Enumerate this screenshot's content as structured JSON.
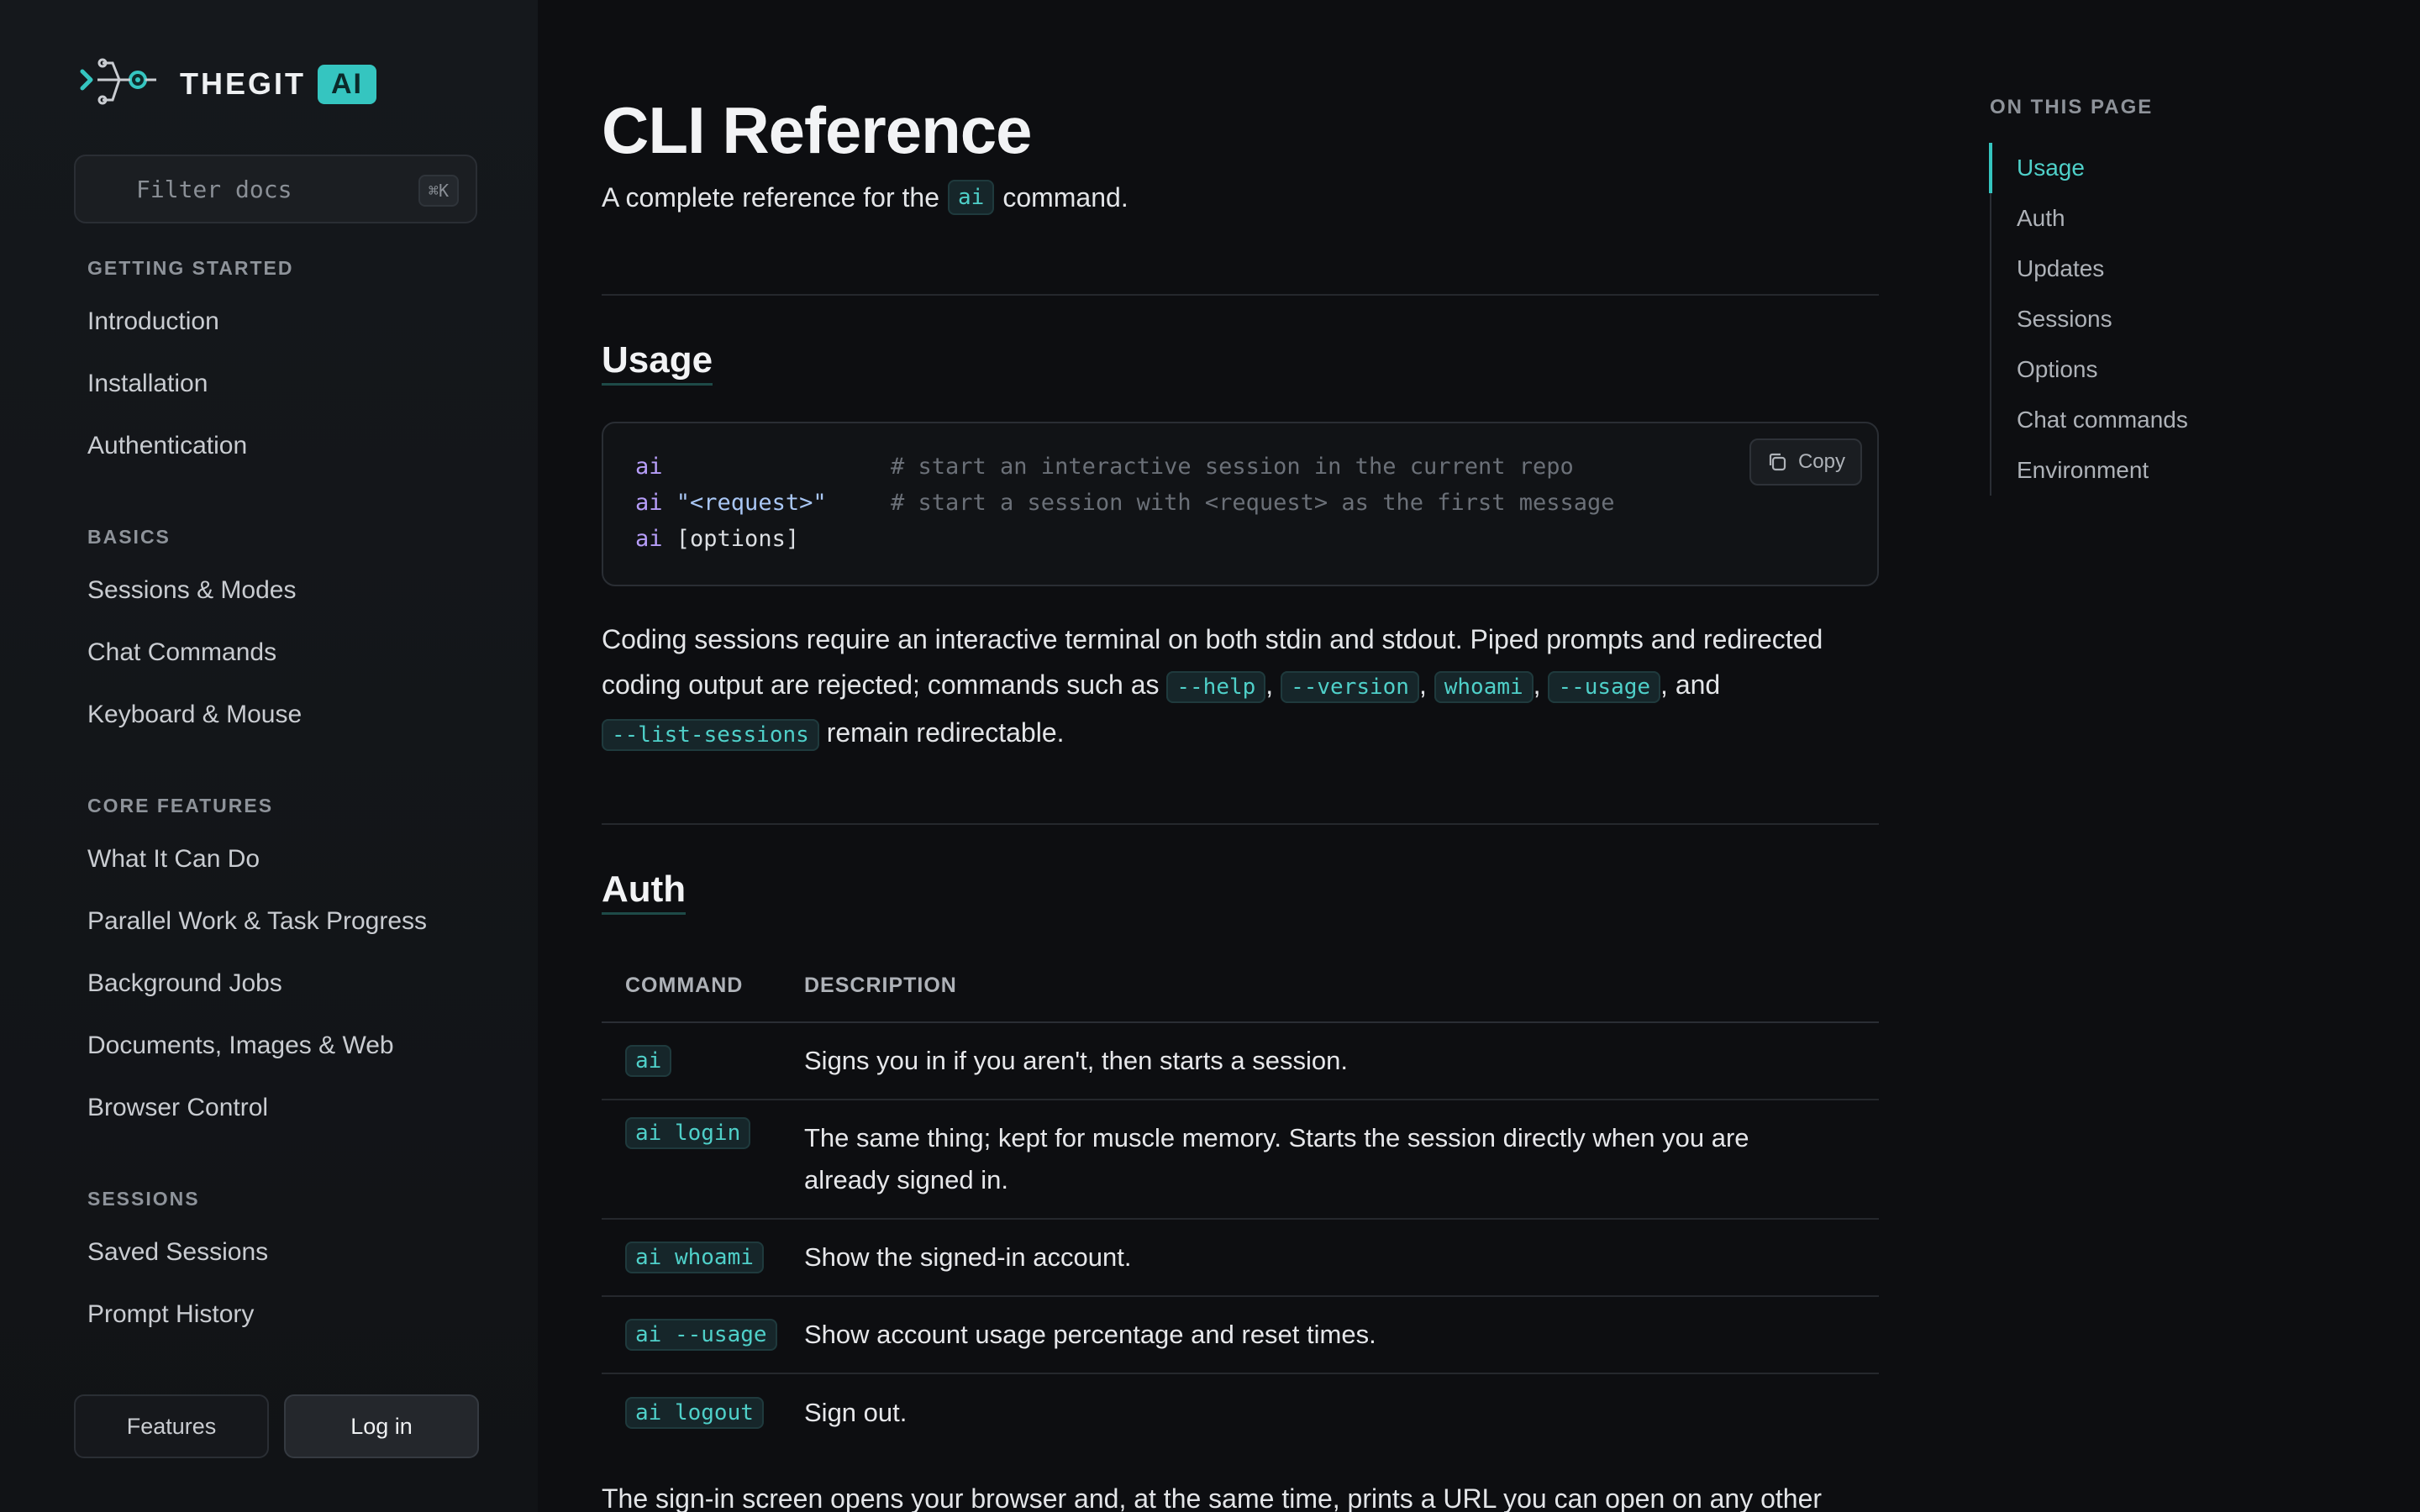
{
  "brand": {
    "name": "THEGIT",
    "badge": "AI"
  },
  "sidebar": {
    "filter_placeholder": "Filter docs",
    "shortcut": "⌘K",
    "sections": [
      {
        "heading": "GETTING STARTED",
        "items": [
          "Introduction",
          "Installation",
          "Authentication"
        ]
      },
      {
        "heading": "BASICS",
        "items": [
          "Sessions & Modes",
          "Chat Commands",
          "Keyboard & Mouse"
        ]
      },
      {
        "heading": "CORE FEATURES",
        "items": [
          "What It Can Do",
          "Parallel Work & Task Progress",
          "Background Jobs",
          "Documents, Images & Web",
          "Browser Control"
        ]
      },
      {
        "heading": "SESSIONS",
        "items": [
          "Saved Sessions",
          "Prompt History"
        ]
      }
    ],
    "buttons": {
      "features": "Features",
      "login": "Log in"
    }
  },
  "main": {
    "title": "CLI Reference",
    "subtitle_pre": "A complete reference for the",
    "subtitle_code": "ai",
    "subtitle_post": "command.",
    "usage": {
      "heading": "Usage",
      "copy_label": "Copy",
      "lines": [
        {
          "cmd": "ai",
          "arg": "",
          "comment": "# start an interactive session in the current repo"
        },
        {
          "cmd": "ai",
          "arg": "\"<request>\"",
          "comment": "# start a session with <request> as the first message"
        },
        {
          "cmd": "ai",
          "arg": "[options]",
          "comment": ""
        }
      ],
      "para_1": "Coding sessions require an interactive terminal on both stdin and stdout. Piped prompts and redirected",
      "para_2": "coding output are rejected; commands such as",
      "flags": [
        "--help",
        "--version",
        "whoami",
        "--usage"
      ],
      "para_and": ", and",
      "flag_last": "--list-sessions",
      "para_end": "remain redirectable."
    },
    "auth": {
      "heading": "Auth",
      "columns": [
        "COMMAND",
        "DESCRIPTION"
      ],
      "rows": [
        {
          "command": "ai",
          "description": "Signs you in if you aren't, then starts a session."
        },
        {
          "command": "ai login",
          "description": "The same thing; kept for muscle memory. Starts the session directly when you are already signed in."
        },
        {
          "command": "ai whoami",
          "description": "Show the signed-in account."
        },
        {
          "command": "ai --usage",
          "description": "Show account usage percentage and reset times."
        },
        {
          "command": "ai logout",
          "description": "Sign out."
        }
      ],
      "after_text": "The sign-in screen opens your browser and, at the same time, prints a URL you can open on any other"
    }
  },
  "toc": {
    "heading": "ON THIS PAGE",
    "items": [
      "Usage",
      "Auth",
      "Updates",
      "Sessions",
      "Options",
      "Chat commands",
      "Environment"
    ]
  },
  "colors": {
    "accent": "#35c5c0",
    "background": "#0d0e11",
    "code_text": "#4fd0c9"
  }
}
